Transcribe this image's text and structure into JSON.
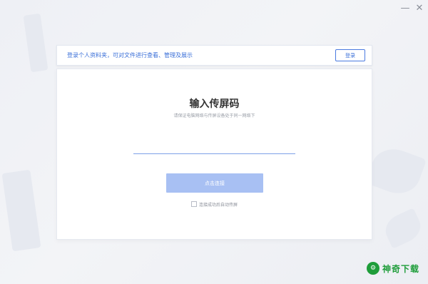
{
  "window": {
    "minimize_label": "—",
    "close_label": "✕"
  },
  "banner": {
    "text": "登录个人资料夹，可对文件进行查看、管理及展示",
    "login_label": "登录"
  },
  "card": {
    "title": "输入传屏码",
    "subtitle": "请保证电脑网络与传屏设备处于同一网络下",
    "code_value": "",
    "connect_label": "点击连接",
    "auto_label": "连接成功后自动传屏"
  },
  "watermark": {
    "logo_glyph": "⚙",
    "text": "神奇下载"
  },
  "colors": {
    "accent": "#3a6fd8",
    "button_disabled": "#a8c0f3",
    "watermark": "#1e9d3a"
  }
}
